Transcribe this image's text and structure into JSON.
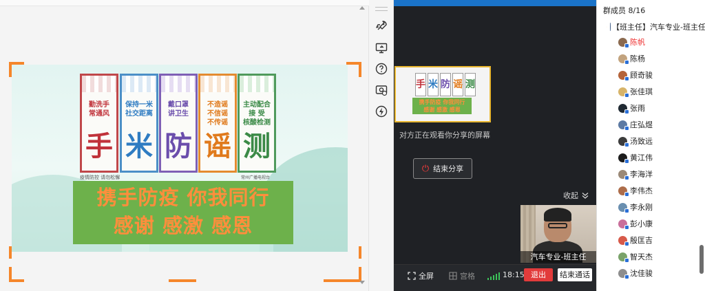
{
  "poster": {
    "panels": [
      {
        "slogan": "勤洗手\n常通风",
        "char": "手"
      },
      {
        "slogan": "保持一米\n社交距离",
        "char": "米"
      },
      {
        "slogan": "戴口罩\n讲卫生",
        "char": "防"
      },
      {
        "slogan": "不造谣\n不信谣\n不传谣",
        "char": "谣"
      },
      {
        "slogan": "主动配合\n接 受\n核酸检测",
        "char": "测"
      }
    ],
    "footer_left": "疫情防控  请勿松懈",
    "footer_right": "常州广播电视台",
    "slogan_line1": "携手防疫  你我同行",
    "slogan_line2": "感谢 感激 感恩"
  },
  "thumb": {
    "chars": [
      "手",
      "米",
      "防",
      "谣",
      "测"
    ],
    "slogan_line1": "携手防疫 你我同行",
    "slogan_line2": "感谢 感激 感恩"
  },
  "meeting": {
    "share_notice": "对方正在观看你分享的屏幕",
    "end_share_label": "结束分享",
    "collapse_label": "收起",
    "video_name": "汽车专业-班主任",
    "fullscreen_label": "全屏",
    "grid_label": "宫格",
    "call_time": "18:15",
    "exit_label": "退出",
    "end_call_label": "结束通话"
  },
  "members": {
    "header": "群成员 8/16",
    "owner": "【班主任】汽车专业-班主任",
    "list": [
      {
        "name": "陈帆",
        "host": true,
        "color": "#8b6a4f"
      },
      {
        "name": "陈杨",
        "host": false,
        "color": "#c2a37e"
      },
      {
        "name": "顾奇骏",
        "host": false,
        "color": "#b5643a"
      },
      {
        "name": "张佳琪",
        "host": false,
        "color": "#d7b46a"
      },
      {
        "name": "张雨",
        "host": false,
        "color": "#202a33"
      },
      {
        "name": "庄弘煜",
        "host": false,
        "color": "#5d7aa3"
      },
      {
        "name": "汤致远",
        "host": false,
        "color": "#3c3c3c"
      },
      {
        "name": "黄江伟",
        "host": false,
        "color": "#1c1c1c"
      },
      {
        "name": "李海洋",
        "host": false,
        "color": "#9b8977"
      },
      {
        "name": "李伟杰",
        "host": false,
        "color": "#ad6d4a"
      },
      {
        "name": "李永刚",
        "host": false,
        "color": "#6a8fb0"
      },
      {
        "name": "彭小康",
        "host": false,
        "color": "#c96f9b"
      },
      {
        "name": "殷匡吉",
        "host": false,
        "color": "#d75a4a"
      },
      {
        "name": "智天杰",
        "host": false,
        "color": "#7aa36a"
      },
      {
        "name": "沈佳骏",
        "host": false,
        "color": "#8e8e8e"
      }
    ]
  },
  "icons": {
    "rocket": "rocket-icon",
    "screen": "screen-share-icon",
    "help": "help-icon",
    "record": "record-icon",
    "power": "power-icon"
  }
}
